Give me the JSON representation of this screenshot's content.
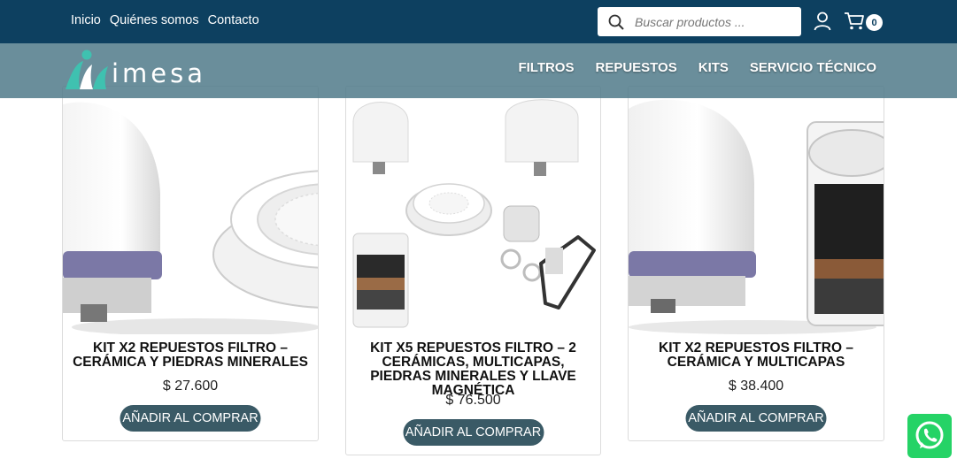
{
  "topbar": {
    "links": [
      "Inicio",
      "Quiénes somos",
      "Contacto"
    ],
    "search_placeholder": "Buscar productos ...",
    "cart_count": "0"
  },
  "brand": {
    "logo_text": "imesa"
  },
  "nav": {
    "items": [
      "FILTROS",
      "REPUESTOS",
      "KITS",
      "SERVICIO TÉCNICO"
    ]
  },
  "products": [
    {
      "title": "KIT X2 REPUESTOS FILTRO – CERÁMICA Y PIEDRAS MINERALES",
      "price": "$ 27.600",
      "button": "AÑADIR AL COMPRAR"
    },
    {
      "title": "KIT X5 REPUESTOS FILTRO – 2 CERÁMICAS, MULTICAPAS, PIEDRAS MINERALES Y LLAVE MAGNÉTICA",
      "price": "$ 76.500",
      "button": "AÑADIR AL COMPRAR"
    },
    {
      "title": "KIT X2 REPUESTOS FILTRO – CERÁMICA Y MULTICAPAS",
      "price": "$ 38.400",
      "button": "AÑADIR AL COMPRAR"
    }
  ],
  "colors": {
    "topbar": "#0d4060",
    "navbar": "#507a8a",
    "button": "#3a5a66",
    "whatsapp": "#25d366"
  }
}
